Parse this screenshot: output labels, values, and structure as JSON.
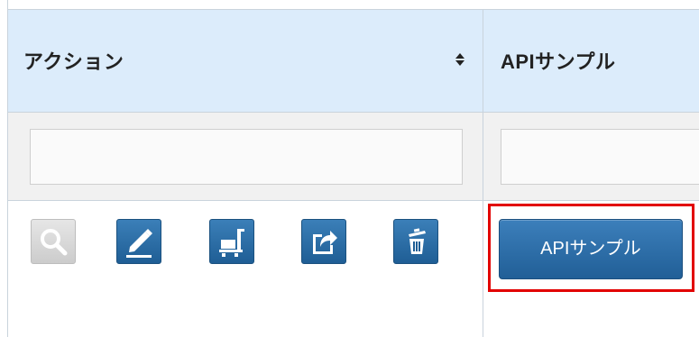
{
  "table": {
    "columns": [
      {
        "label": "アクション",
        "sortable": true
      },
      {
        "label": "APIサンプル",
        "sortable": false
      }
    ],
    "filters": [
      {
        "value": "",
        "placeholder": ""
      },
      {
        "value": "",
        "placeholder": ""
      }
    ],
    "row": {
      "actions": [
        {
          "icon": "search-icon",
          "enabled": false
        },
        {
          "icon": "edit-icon",
          "enabled": true
        },
        {
          "icon": "cart-icon",
          "enabled": true
        },
        {
          "icon": "share-icon",
          "enabled": true
        },
        {
          "icon": "trash-icon",
          "enabled": true
        }
      ],
      "api_button_label": "APIサンプル"
    }
  },
  "colors": {
    "header_bg": "#dcecfb",
    "button_blue": "#2a6aa6",
    "highlight": "#e20000"
  }
}
